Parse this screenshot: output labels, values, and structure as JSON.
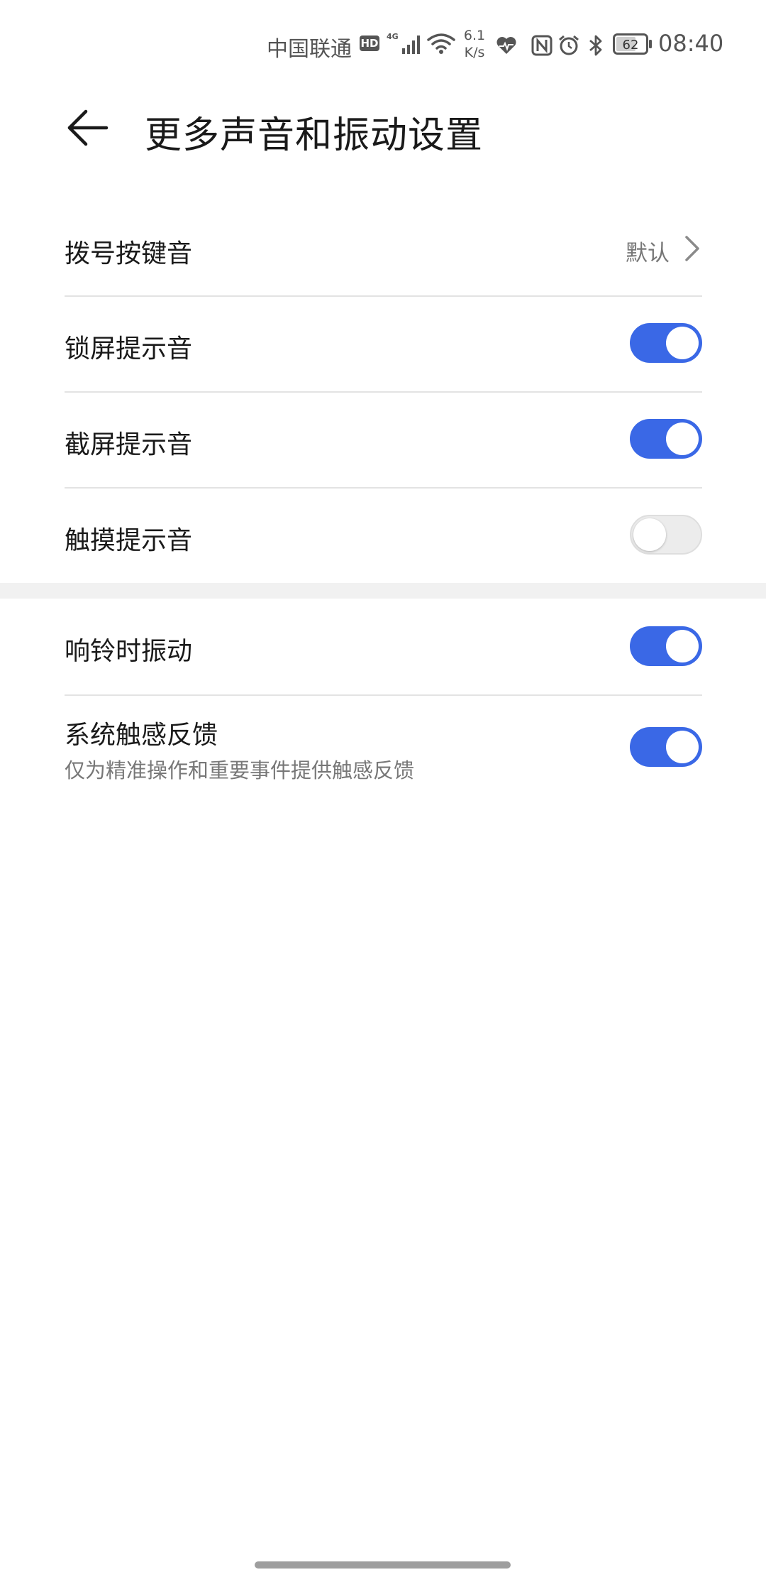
{
  "status_bar": {
    "carrier": "中国联通",
    "hd_badge": "HD",
    "network_type": "4G",
    "speed_value": "6.1",
    "speed_unit": "K/s",
    "battery_level": "62",
    "time": "08:40",
    "icons": [
      "signal-icon",
      "wifi-icon",
      "health-icon",
      "nfc-icon",
      "alarm-icon",
      "bluetooth-icon",
      "battery-icon"
    ]
  },
  "header": {
    "back_icon": "arrow-left-icon",
    "title": "更多声音和振动设置"
  },
  "colors": {
    "accent": "#3a68e6",
    "toggle_off": "#ececec",
    "text_primary": "#1a1a1a",
    "text_secondary": "#777777",
    "divider": "#e3e3e3",
    "section_gap": "#f1f1f1"
  },
  "settings": {
    "dial_pad_tone": {
      "label": "拨号按键音",
      "value": "默认"
    },
    "lock_screen_sound": {
      "label": "锁屏提示音",
      "enabled": true
    },
    "screenshot_sound": {
      "label": "截屏提示音",
      "enabled": true
    },
    "touch_sound": {
      "label": "触摸提示音",
      "enabled": false
    },
    "vibrate_on_ring": {
      "label": "响铃时振动",
      "enabled": true
    },
    "haptic_feedback": {
      "label": "系统触感反馈",
      "description": "仅为精准操作和重要事件提供触感反馈",
      "enabled": true
    }
  }
}
